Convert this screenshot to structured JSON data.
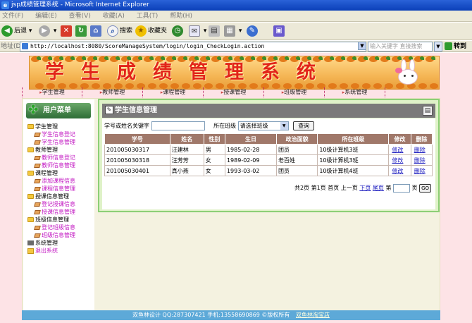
{
  "window": {
    "title": "jsp成绩管理系统 - Microsoft Internet Explorer",
    "menu": [
      "文件(F)",
      "编辑(E)",
      "查看(V)",
      "收藏(A)",
      "工具(T)",
      "帮助(H)"
    ]
  },
  "toolbar": {
    "back_label": "后退",
    "search_label": "搜索",
    "favorites_label": "收藏夹"
  },
  "address": {
    "label": "地址(D)",
    "url": "http://localhost:8080/ScoreManageSystem/login/login_CheckLogin.action",
    "keyword_placeholder": "输入关键字 直接搜索",
    "go_label": "转到"
  },
  "banner": {
    "title": "学生成绩管理系统"
  },
  "nav": [
    "学生管理",
    "教师管理",
    "课程管理",
    "授课管理",
    "班级管理",
    "系统管理"
  ],
  "sidebar": {
    "header": "用户菜单",
    "groups": [
      {
        "label": "学生管理",
        "children": [
          "学生信息登记",
          "学生信息管理"
        ]
      },
      {
        "label": "教师管理",
        "children": [
          "教师信息登记",
          "教师信息管理"
        ]
      },
      {
        "label": "课程管理",
        "children": [
          "添加课程信息",
          "课程信息管理"
        ]
      },
      {
        "label": "授课信息管理",
        "children": [
          "登记授课信息",
          "授课信息管理"
        ]
      },
      {
        "label": "班级信息管理",
        "children": [
          "登记班级信息",
          "班级信息管理"
        ]
      }
    ],
    "system": "系统管理",
    "logout": "退出系统"
  },
  "panel": {
    "title": "学生信息管理",
    "keyword_label": "学号或姓名关键字",
    "class_label": "所在班级",
    "class_select": "请选择班级",
    "query_button": "查询",
    "columns": [
      "学号",
      "姓名",
      "性别",
      "生日",
      "政治面貌",
      "所在班级",
      "修改",
      "删除"
    ],
    "rows": [
      [
        "201005030317",
        "汪建林",
        "男",
        "1985-02-28",
        "团员",
        "10级计算机3班",
        "修改",
        "删除"
      ],
      [
        "201005030318",
        "汪芳芳",
        "女",
        "1989-02-09",
        "老百姓",
        "10级计算机3班",
        "修改",
        "删除"
      ],
      [
        "201005030401",
        "真小燕",
        "女",
        "1993-03-02",
        "团员",
        "10级计算机4班",
        "修改",
        "删除"
      ]
    ],
    "pager": {
      "total": "共2页",
      "current": "第1页",
      "first": "首页",
      "prev": "上一页",
      "next": "下页",
      "last": "尾页",
      "goto_label": "第",
      "goto_suffix": "页",
      "go_button": "GO"
    }
  },
  "footer": {
    "text": "双鱼林设计 QQ:287307421 手机:13558690869 ©版权所有",
    "shop_link": "双鱼林淘宝店"
  }
}
